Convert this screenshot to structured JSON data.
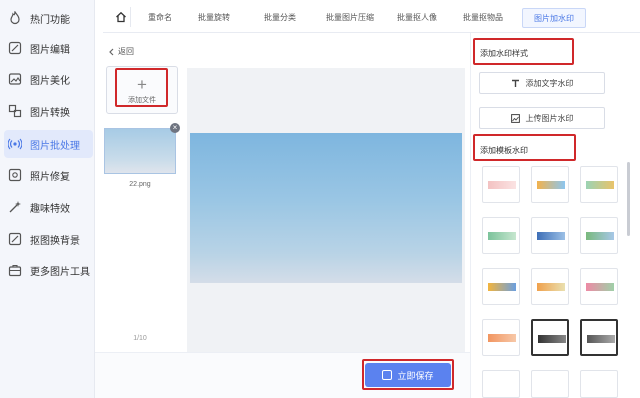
{
  "sidebar": {
    "items": [
      {
        "label": "热门功能",
        "icon": "fire-icon",
        "active": false
      },
      {
        "label": "图片编辑",
        "icon": "edit-icon",
        "active": false
      },
      {
        "label": "图片美化",
        "icon": "image-icon",
        "active": false
      },
      {
        "label": "图片转换",
        "icon": "convert-icon",
        "active": false
      },
      {
        "label": "图片批处理",
        "icon": "batch-icon",
        "active": true
      },
      {
        "label": "照片修复",
        "icon": "repair-icon",
        "active": false
      },
      {
        "label": "趣味特效",
        "icon": "magic-icon",
        "active": false
      },
      {
        "label": "抠图换背景",
        "icon": "cutout-icon",
        "active": false
      },
      {
        "label": "更多图片工具",
        "icon": "toolbox-icon",
        "active": false
      }
    ]
  },
  "tabs": [
    {
      "label": "重命名"
    },
    {
      "label": "批量旋转"
    },
    {
      "label": "批量分类"
    },
    {
      "label": "批量图片压缩"
    },
    {
      "label": "批量抠人像"
    },
    {
      "label": "批量抠物品"
    },
    {
      "label": "图片加水印",
      "active": true
    }
  ],
  "content": {
    "back_label": "返回",
    "add_file_label": "添加文件",
    "thumbnail_name": "22.png",
    "pager": "1/10",
    "save_label": "立即保存"
  },
  "right_panel": {
    "style_title": "添加水印样式",
    "text_watermark_label": "添加文字水印",
    "image_watermark_label": "上传图片水印",
    "template_title": "添加模板水印",
    "template_count": 15
  },
  "colors": {
    "accent": "#5b82ef",
    "highlight": "#d0282a",
    "sidebar_active_bg": "#e2e9fb"
  }
}
